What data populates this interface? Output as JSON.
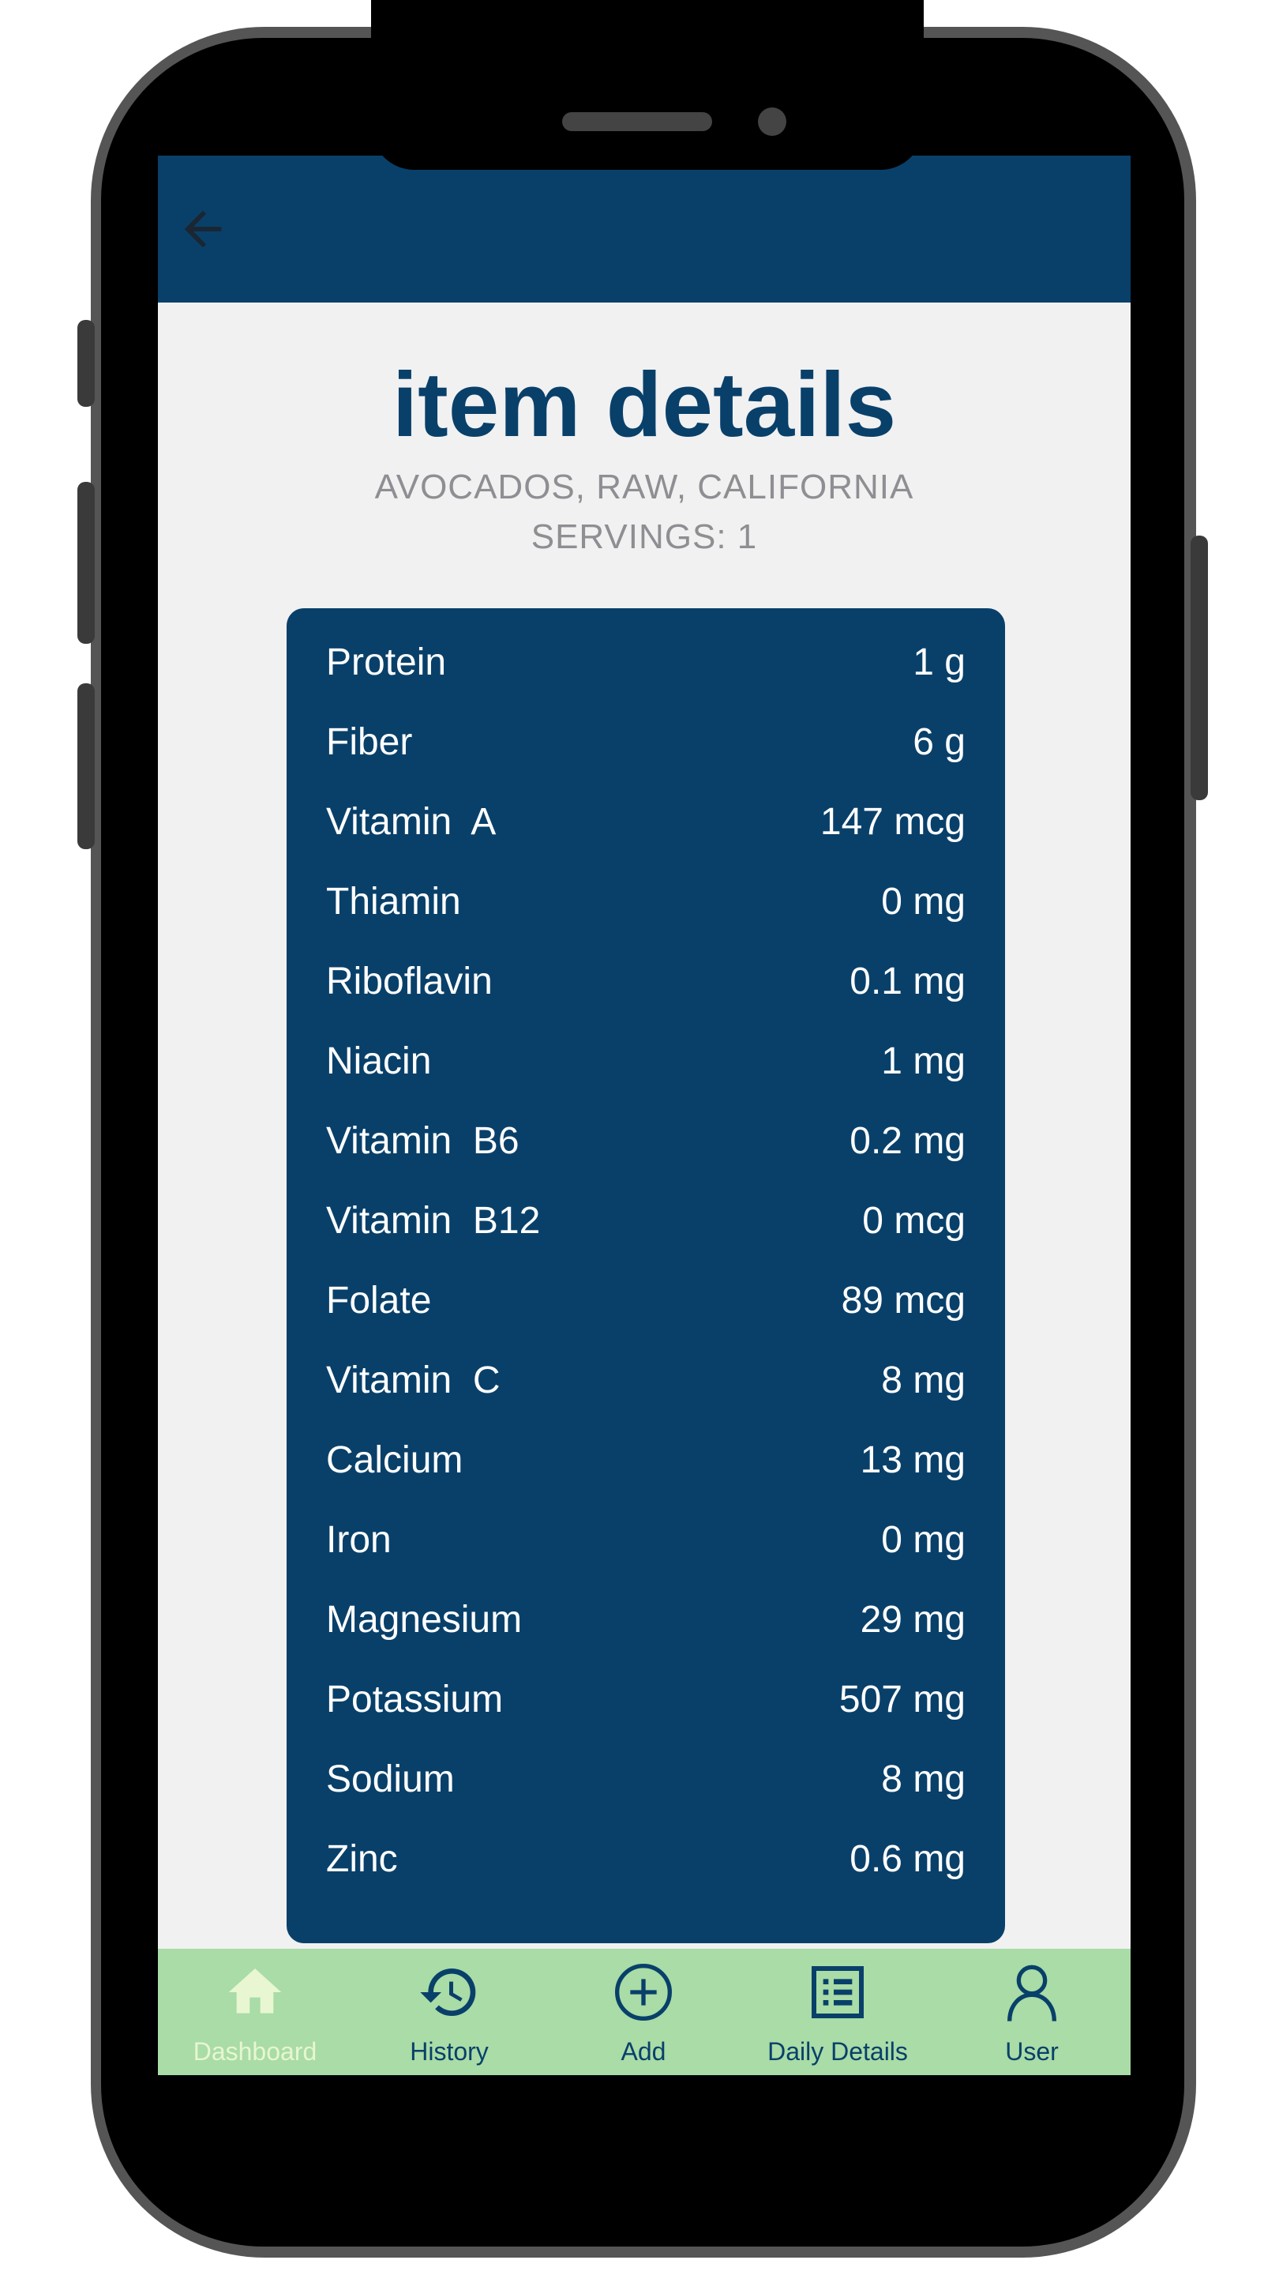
{
  "header": {
    "back_label": "Back"
  },
  "page": {
    "title": "item details",
    "food_name": "AVOCADOS, RAW, CALIFORNIA",
    "servings": "SERVINGS: 1"
  },
  "nutrients": [
    {
      "name": "Protein",
      "value": "1 g"
    },
    {
      "name": "Fiber",
      "value": "6 g"
    },
    {
      "name": "Vitamin  A",
      "value": "147 mcg"
    },
    {
      "name": "Thiamin",
      "value": "0 mg"
    },
    {
      "name": "Riboflavin",
      "value": "0.1 mg"
    },
    {
      "name": "Niacin",
      "value": "1 mg"
    },
    {
      "name": "Vitamin  B6",
      "value": "0.2 mg"
    },
    {
      "name": "Vitamin  B12",
      "value": "0 mcg"
    },
    {
      "name": "Folate",
      "value": "89 mcg"
    },
    {
      "name": "Vitamin  C",
      "value": "8 mg"
    },
    {
      "name": "Calcium",
      "value": "13 mg"
    },
    {
      "name": "Iron",
      "value": "0 mg"
    },
    {
      "name": "Magnesium",
      "value": "29 mg"
    },
    {
      "name": "Potassium",
      "value": "507 mg"
    },
    {
      "name": "Sodium",
      "value": "8 mg"
    },
    {
      "name": "Zinc",
      "value": "0.6 mg"
    }
  ],
  "nav": {
    "items": [
      {
        "label": "Dashboard",
        "icon": "home-icon",
        "active": true
      },
      {
        "label": "History",
        "icon": "history-icon",
        "active": false
      },
      {
        "label": "Add",
        "icon": "add-circle-icon",
        "active": false
      },
      {
        "label": "Daily Details",
        "icon": "list-icon",
        "active": false
      },
      {
        "label": "User",
        "icon": "user-icon",
        "active": false
      }
    ]
  },
  "colors": {
    "primary": "#09406a",
    "nav_background": "#a9dca6",
    "nav_active": "#e8f6d2",
    "page_background": "#f1f1f2",
    "subtitle": "#8e8e93"
  }
}
